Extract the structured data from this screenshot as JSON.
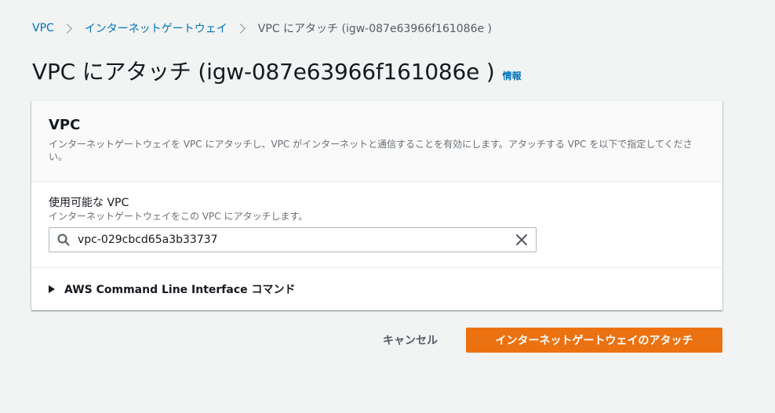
{
  "breadcrumb": {
    "items": [
      {
        "label": "VPC"
      },
      {
        "label": "インターネットゲートウェイ"
      }
    ],
    "current": "VPC にアタッチ (igw-087e63966f161086e )"
  },
  "page": {
    "title": "VPC にアタッチ (igw-087e63966f161086e )",
    "info_link": "情報"
  },
  "panel": {
    "title": "VPC",
    "description": "インターネットゲートウェイを VPC にアタッチし、VPC がインターネットと通信することを有効にします。アタッチする VPC を以下で指定してください。",
    "field": {
      "label": "使用可能な VPC",
      "description": "インターネットゲートウェイをこの VPC にアタッチします。",
      "value": "vpc-029cbcd65a3b33737",
      "icon": "search-icon",
      "clear_icon": "close-icon"
    },
    "cli_expander": {
      "label": "AWS Command Line Interface コマンド",
      "icon": "caret-right-icon"
    }
  },
  "actions": {
    "cancel_label": "キャンセル",
    "primary_label": "インターネットゲートウェイのアタッチ"
  },
  "colors": {
    "link": "#0073bb",
    "primary_button": "#ec7211",
    "background": "#f2f3f3"
  }
}
